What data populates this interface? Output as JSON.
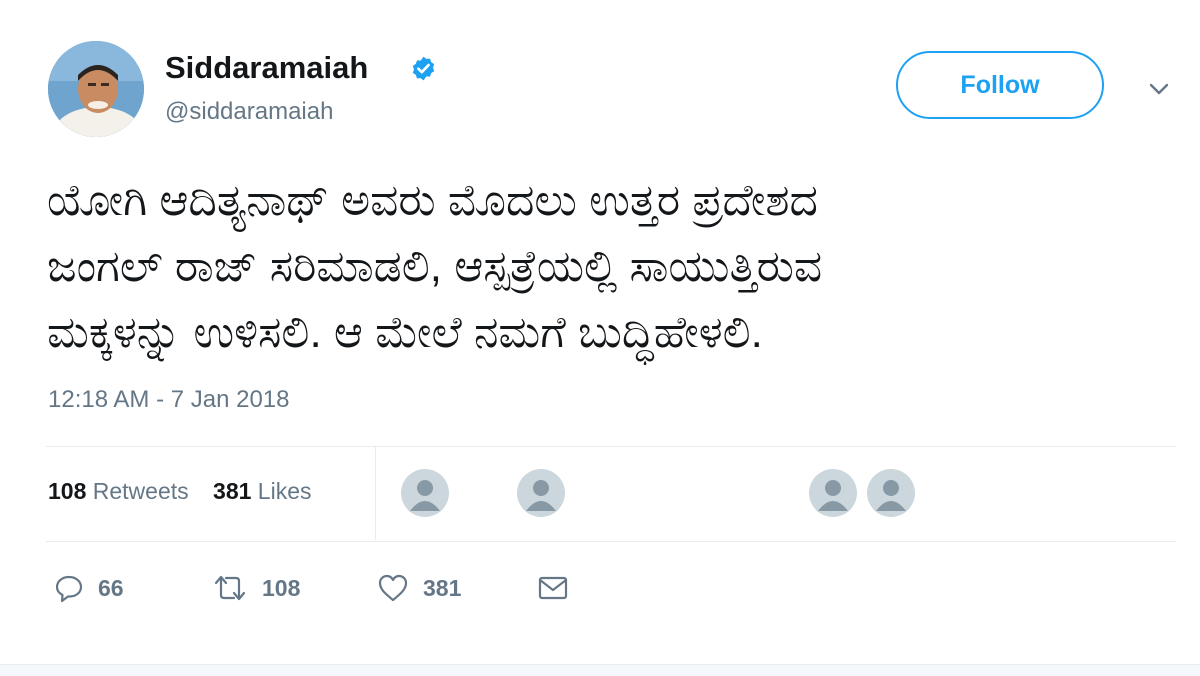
{
  "author": {
    "display_name": "Siddaramaiah",
    "handle": "@siddaramaiah",
    "verified": true
  },
  "follow_label": "Follow",
  "tweet": {
    "lines": [
      "ಯೋಗಿ ಆದಿತ್ಯನಾಥ್ ಅವರು ಮೊದಲು ಉತ್ತರ ಪ್ರದೇಶದ",
      "ಜಂಗಲ್ ರಾಜ್ ಸರಿಮಾಡಲಿ, ಆಸ್ಪತ್ರೆಯಲ್ಲಿ ಸಾಯುತ್ತಿರುವ",
      "ಮಕ್ಕಳನ್ನು ಉಳಿಸಲಿ. ಆ ಮೇಲೆ ನಮಗೆ ಬುದ್ಧಿಹೇಳಲಿ."
    ],
    "timestamp": "12:18 AM - 7 Jan 2018"
  },
  "stats": {
    "retweets_count": "108",
    "retweets_label": "Retweets",
    "likes_count": "381",
    "likes_label": "Likes"
  },
  "actions": {
    "reply_count": "66",
    "retweet_count": "108",
    "like_count": "381"
  },
  "icons": {
    "verified": "verified-badge-icon",
    "caret": "chevron-down-icon",
    "reply": "reply-icon",
    "retweet": "retweet-icon",
    "like": "heart-icon",
    "dm": "envelope-icon",
    "liker_avatar": "default-user-icon"
  },
  "colors": {
    "accent": "#1da1f2",
    "text": "#14171a",
    "muted": "#657786",
    "border": "#e6ecf0",
    "placeholder_avatar": "#ccd6dd"
  }
}
